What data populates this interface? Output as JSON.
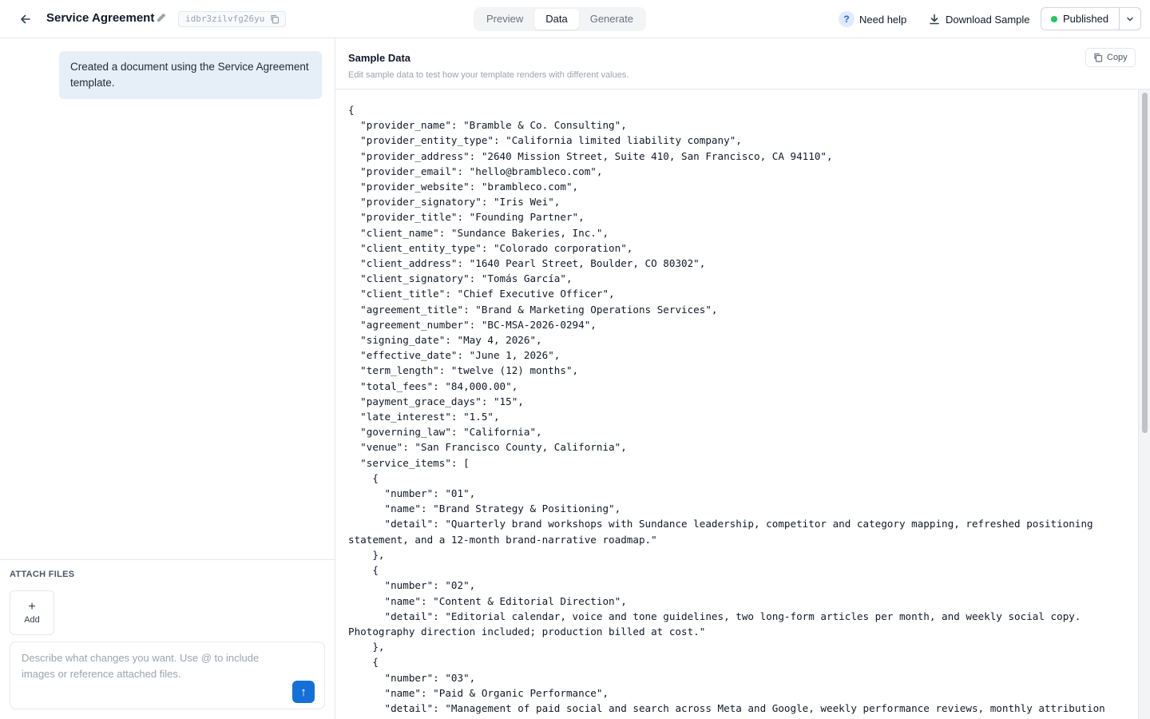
{
  "header": {
    "title": "Service Agreement",
    "template_id": "idbr3zilvfg26yu",
    "tabs": [
      {
        "label": "Preview",
        "active": false
      },
      {
        "label": "Data",
        "active": true
      },
      {
        "label": "Generate",
        "active": false
      }
    ],
    "help_label": "Need help",
    "help_glyph": "?",
    "download_label": "Download Sample",
    "status_label": "Published",
    "status_color": "#22c55e",
    "icons": [
      "back-arrow-icon",
      "pencil-icon",
      "copy-icon",
      "download-icon",
      "chevron-down-icon"
    ]
  },
  "chat": {
    "messages": [
      {
        "role": "system",
        "text": "Created a document using the Service Agreement template."
      }
    ],
    "attach_label": "ATTACH FILES",
    "add_glyph": "+",
    "add_label": "Add",
    "prompt_placeholder": "Describe what changes you want. Use @ to include images or reference attached files.",
    "prompt_value": "",
    "send_glyph": "↑",
    "send_color": "#1470d6"
  },
  "sample_data": {
    "title": "Sample Data",
    "subtitle": "Edit sample data to test how your template renders with different values.",
    "copy_label": "Copy",
    "code": "{\n  \"provider_name\": \"Bramble & Co. Consulting\",\n  \"provider_entity_type\": \"California limited liability company\",\n  \"provider_address\": \"2640 Mission Street, Suite 410, San Francisco, CA 94110\",\n  \"provider_email\": \"hello@brambleco.com\",\n  \"provider_website\": \"brambleco.com\",\n  \"provider_signatory\": \"Iris Wei\",\n  \"provider_title\": \"Founding Partner\",\n  \"client_name\": \"Sundance Bakeries, Inc.\",\n  \"client_entity_type\": \"Colorado corporation\",\n  \"client_address\": \"1640 Pearl Street, Boulder, CO 80302\",\n  \"client_signatory\": \"Tomás García\",\n  \"client_title\": \"Chief Executive Officer\",\n  \"agreement_title\": \"Brand & Marketing Operations Services\",\n  \"agreement_number\": \"BC-MSA-2026-0294\",\n  \"signing_date\": \"May 4, 2026\",\n  \"effective_date\": \"June 1, 2026\",\n  \"term_length\": \"twelve (12) months\",\n  \"total_fees\": \"84,000.00\",\n  \"payment_grace_days\": \"15\",\n  \"late_interest\": \"1.5\",\n  \"governing_law\": \"California\",\n  \"venue\": \"San Francisco County, California\",\n  \"service_items\": [\n    {\n      \"number\": \"01\",\n      \"name\": \"Brand Strategy & Positioning\",\n      \"detail\": \"Quarterly brand workshops with Sundance leadership, competitor and category mapping, refreshed positioning statement, and a 12-month brand-narrative roadmap.\"\n    },\n    {\n      \"number\": \"02\",\n      \"name\": \"Content & Editorial Direction\",\n      \"detail\": \"Editorial calendar, voice and tone guidelines, two long-form articles per month, and weekly social copy. Photography direction included; production billed at cost.\"\n    },\n    {\n      \"number\": \"03\",\n      \"name\": \"Paid & Organic Performance\",\n      \"detail\": \"Management of paid social and search across Meta and Google, weekly performance reviews, monthly attribution"
  }
}
